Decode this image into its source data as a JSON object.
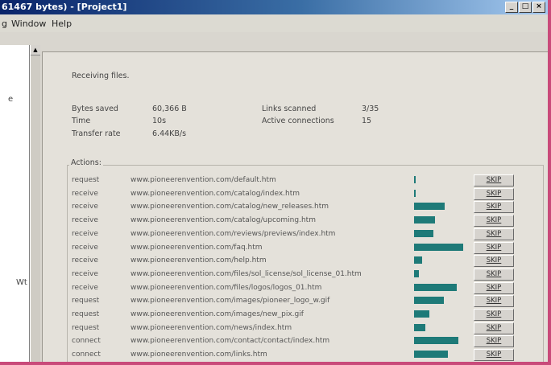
{
  "window": {
    "title": "61467 bytes) - [Project1]",
    "buttons": [
      "_",
      "□",
      "×"
    ]
  },
  "menu": [
    "g",
    "Window",
    "Help"
  ],
  "left_pane": {
    "fragments": [
      "e",
      "Wt"
    ]
  },
  "status": {
    "heading": "Receiving files.",
    "bytes_saved_label": "Bytes saved",
    "bytes_saved_value": "60,366 B",
    "time_label": "Time",
    "time_value": "10s",
    "transfer_rate_label": "Transfer rate",
    "transfer_rate_value": "6.44KB/s",
    "links_scanned_label": "Links scanned",
    "links_scanned_value": "3/35",
    "active_connections_label": "Active connections",
    "active_connections_value": "15"
  },
  "actions": {
    "title": "Actions:",
    "skip_label": "SKIP",
    "rows": [
      {
        "type": "request",
        "url": "www.pioneerenvention.com/default.htm",
        "progress": 0.04
      },
      {
        "type": "receive",
        "url": "www.pioneerenvention.com/catalog/index.htm",
        "progress": 0.04
      },
      {
        "type": "receive",
        "url": "www.pioneerenvention.com/catalog/new_releases.htm",
        "progress": 0.62
      },
      {
        "type": "receive",
        "url": "www.pioneerenvention.com/catalog/upcoming.htm",
        "progress": 0.42
      },
      {
        "type": "receive",
        "url": "www.pioneerenvention.com/reviews/previews/index.htm",
        "progress": 0.38
      },
      {
        "type": "receive",
        "url": "www.pioneerenvention.com/faq.htm",
        "progress": 0.98
      },
      {
        "type": "receive",
        "url": "www.pioneerenvention.com/help.htm",
        "progress": 0.16
      },
      {
        "type": "receive",
        "url": "www.pioneerenvention.com/files/sol_license/sol_license_01.htm",
        "progress": 0.1
      },
      {
        "type": "receive",
        "url": "www.pioneerenvention.com/files/logos/logos_01.htm",
        "progress": 0.86
      },
      {
        "type": "request",
        "url": "www.pioneerenvention.com/images/pioneer_logo_w.gif",
        "progress": 0.6
      },
      {
        "type": "request",
        "url": "www.pioneerenvention.com/images/new_pix.gif",
        "progress": 0.3
      },
      {
        "type": "request",
        "url": "www.pioneerenvention.com/news/index.htm",
        "progress": 0.22
      },
      {
        "type": "connect",
        "url": "www.pioneerenvention.com/contact/contact/index.htm",
        "progress": 0.88
      },
      {
        "type": "connect",
        "url": "www.pioneerenvention.com/links.htm",
        "progress": 0.68
      }
    ]
  },
  "colors": {
    "progress_fill": "#1e7a78",
    "frame_border": "#c94a7a"
  }
}
